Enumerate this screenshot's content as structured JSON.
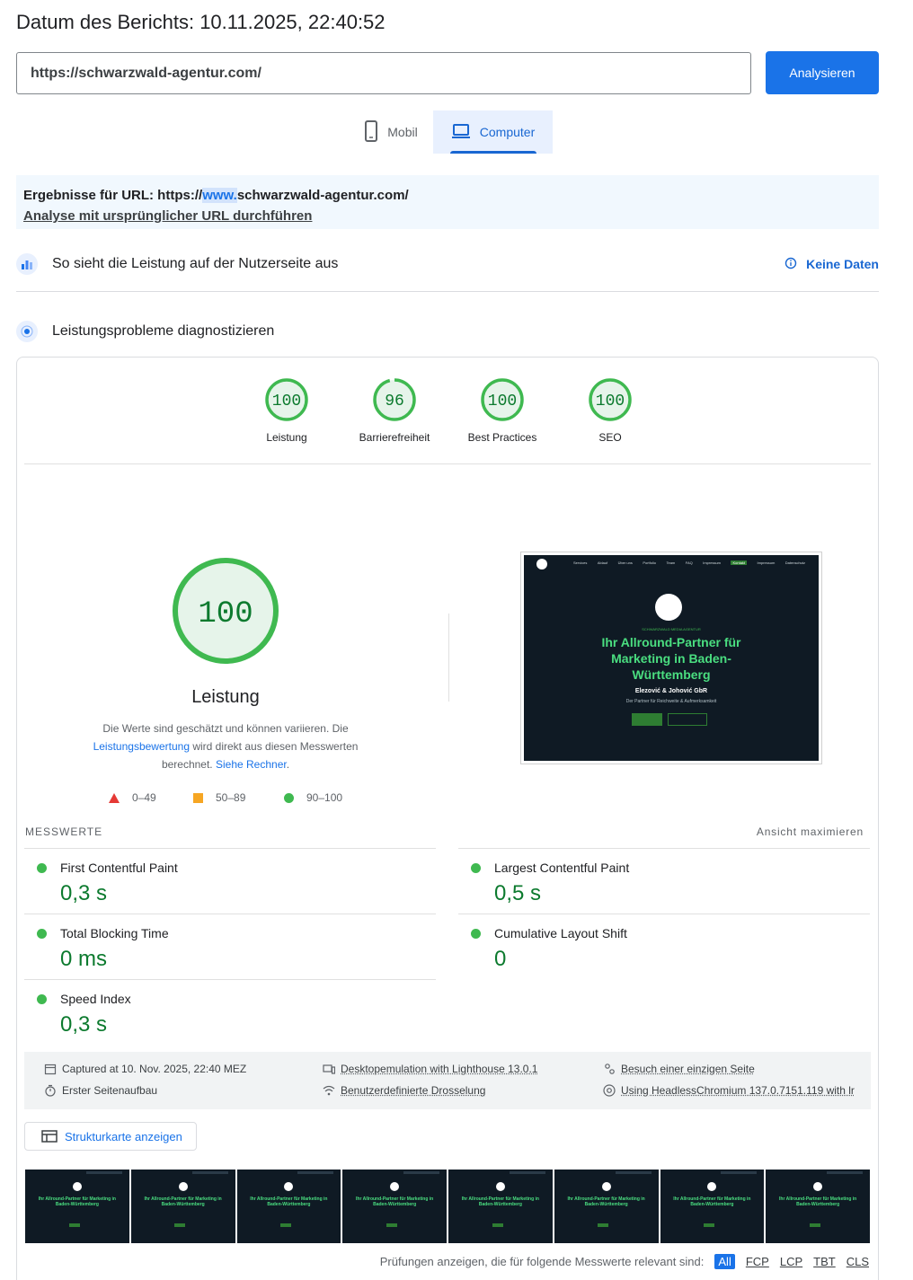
{
  "report": {
    "date_label": "Datum des Berichts: 10.11.2025, 22:40:52"
  },
  "search": {
    "url_value": "https://schwarzwald-agentur.com/",
    "analyze_label": "Analysieren"
  },
  "tabs": [
    {
      "label": "Mobil",
      "icon": "phone-icon"
    },
    {
      "label": "Computer",
      "icon": "laptop-icon",
      "active": true
    }
  ],
  "url_notice": {
    "prefix": "Ergebnisse für URL: https://",
    "highlight": "www.",
    "suffix": "schwarzwald-agentur.com/",
    "link": "Analyse mit ursprünglicher URL durchführen"
  },
  "field_data": {
    "title": "So sieht die Leistung auf der Nutzerseite aus",
    "status": "Keine Daten",
    "icon": "chart-icon"
  },
  "lab": {
    "title": "Leistungsprobleme diagnostizieren",
    "icon": "radar-icon"
  },
  "scores": [
    {
      "label": "Leistung",
      "value": "100",
      "fraction": 1.0
    },
    {
      "label": "Barrierefreiheit",
      "value": "96",
      "fraction": 0.96
    },
    {
      "label": "Best Practices",
      "value": "100",
      "fraction": 1.0
    },
    {
      "label": "SEO",
      "value": "100",
      "fraction": 1.0
    }
  ],
  "performance": {
    "score": "100",
    "label": "Leistung",
    "desc_1": "Die Werte sind geschätzt und können variieren. Die ",
    "desc_link_1": "Leistungsbewertung",
    "desc_2": " wird direkt aus diesen Messwerten berechnet. ",
    "desc_link_2": "Siehe Rechner",
    "desc_3": "."
  },
  "legend": [
    {
      "range": "0–49"
    },
    {
      "range": "50–89"
    },
    {
      "range": "90–100"
    }
  ],
  "screenshot": {
    "nav": [
      "Services",
      "Ablauf",
      "Über uns",
      "Portfolio",
      "Team",
      "FAQ",
      "Impressum",
      "Kontakt",
      "Impressum",
      "Datenschutz"
    ],
    "kicker": "SCHWARZWALD MEDIA AGENTUR",
    "headline": "Ihr Allround-Partner für Marketing in Baden-Württemberg",
    "company": "Elezović & Johović GbR",
    "tagline": "Der Partner für Reichweite & Aufmerksamkeit"
  },
  "metrics": {
    "header": "MESSWERTE",
    "expand": "Ansicht maximieren",
    "items": [
      {
        "name": "First Contentful Paint",
        "value": "0,3 s"
      },
      {
        "name": "Largest Contentful Paint",
        "value": "0,5 s"
      },
      {
        "name": "Total Blocking Time",
        "value": "0 ms"
      },
      {
        "name": "Cumulative Layout Shift",
        "value": "0"
      },
      {
        "name": "Speed Index",
        "value": "0,3 s"
      }
    ]
  },
  "meta": {
    "captured": "Captured at 10. Nov. 2025, 22:40 MEZ",
    "load": "Erster Seitenaufbau",
    "emulation": "Desktopemulation with Lighthouse 13.0.1",
    "throttling": "Benutzerdefinierte Drosselung",
    "session": "Besuch einer einzigen Seite",
    "browser": "Using HeadlessChromium 137.0.7151.119 with lr"
  },
  "treemap": {
    "label": "Strukturkarte anzeigen"
  },
  "filmstrip": {
    "frame_headline": "Ihr Allround-Partner für Marketing in Baden-Württemberg"
  },
  "filter": {
    "label": "Prüfungen anzeigen, die für folgende Messwerte relevant sind:",
    "options": [
      "All",
      "FCP",
      "LCP",
      "TBT",
      "CLS"
    ]
  },
  "colors": {
    "accent": "#1a73e8",
    "pass": "#0c7a2e",
    "pass_ring": "#3fb950",
    "average": "#f6a623",
    "fail": "#e53935"
  }
}
